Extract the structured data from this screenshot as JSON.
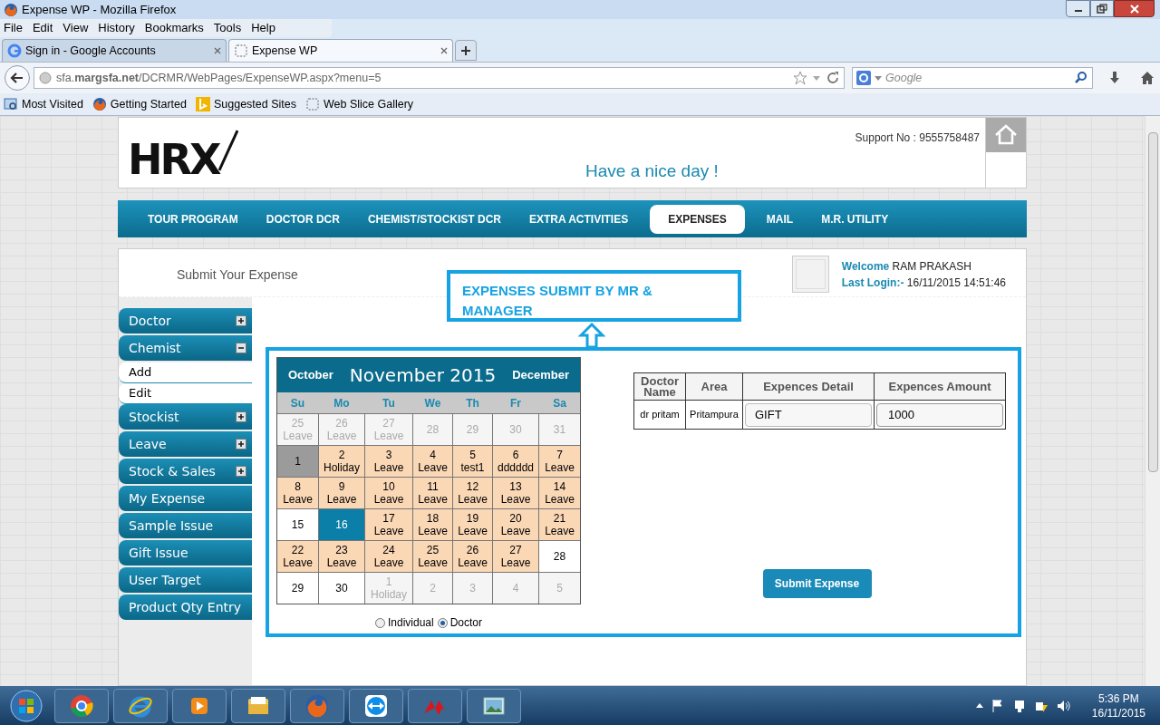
{
  "window": {
    "title": "Expense WP - Mozilla Firefox"
  },
  "menu": [
    "File",
    "Edit",
    "View",
    "History",
    "Bookmarks",
    "Tools",
    "Help"
  ],
  "browser_tabs": [
    {
      "label": "Sign in - Google Accounts",
      "selected": false
    },
    {
      "label": "Expense WP",
      "selected": true
    }
  ],
  "address": "sfa.**margsfa.net**/DCRMR/WebPages/ExpenseWP.aspx?menu=5",
  "search": {
    "placeholder": "Google"
  },
  "bookmarks": [
    "Most Visited",
    "Getting Started",
    "Suggested Sites",
    "Web Slice Gallery"
  ],
  "header": {
    "logo": "HRX",
    "support": "Support No : 9555758487",
    "greeting": "Have a nice day !"
  },
  "nav": [
    {
      "label": "TOUR PROGRAM",
      "selected": false
    },
    {
      "label": "DOCTOR DCR",
      "selected": false
    },
    {
      "label": "CHEMIST/STOCKIST DCR",
      "selected": false
    },
    {
      "label": "EXTRA ACTIVITIES",
      "selected": false
    },
    {
      "label": "EXPENSES",
      "selected": true
    },
    {
      "label": "MAIL",
      "selected": false
    },
    {
      "label": "M.R. UTILITY",
      "selected": false
    }
  ],
  "page_title": "Submit Your Expense",
  "user": {
    "welcome_label": "Welcome",
    "name": "RAM PRAKASH",
    "login_label": "Last Login:-",
    "last_login": "16/11/2015 14:51:46"
  },
  "callout": "EXPENSES SUBMIT BY MR & MANAGER",
  "sidebar": [
    {
      "label": "Doctor",
      "expanded": false
    },
    {
      "label": "Chemist",
      "expanded": true,
      "children": [
        "Add",
        "Edit"
      ]
    },
    {
      "label": "Stockist",
      "expanded": false
    },
    {
      "label": "Leave",
      "expanded": false
    },
    {
      "label": "Stock & Sales",
      "expanded": false
    },
    {
      "label": "My Expense"
    },
    {
      "label": "Sample Issue"
    },
    {
      "label": "Gift Issue"
    },
    {
      "label": "User Target"
    },
    {
      "label": "Product Qty Entry"
    }
  ],
  "calendar": {
    "prev": "October",
    "title": "November 2015",
    "next": "December",
    "weekdays": [
      "Su",
      "Mo",
      "Tu",
      "We",
      "Th",
      "Fr",
      "Sa"
    ],
    "days": [
      {
        "day": "25",
        "note": "Leave",
        "kind": "outside",
        "selected": false
      },
      {
        "day": "26",
        "note": "Leave",
        "kind": "outside",
        "selected": false
      },
      {
        "day": "27",
        "note": "Leave",
        "kind": "outside",
        "selected": false
      },
      {
        "day": "28",
        "kind": "outside",
        "selected": false
      },
      {
        "day": "29",
        "kind": "outside",
        "selected": false
      },
      {
        "day": "30",
        "kind": "outside",
        "selected": false
      },
      {
        "day": "31",
        "kind": "outside",
        "selected": false
      },
      {
        "day": "1",
        "kind": "today",
        "selected": false
      },
      {
        "day": "2",
        "note": "Holiday",
        "kind": "marked",
        "selected": false
      },
      {
        "day": "3",
        "note": "Leave",
        "kind": "marked",
        "selected": false
      },
      {
        "day": "4",
        "note": "Leave",
        "kind": "marked",
        "selected": false
      },
      {
        "day": "5",
        "note": "test1",
        "kind": "marked",
        "selected": false
      },
      {
        "day": "6",
        "note": "dddddd",
        "kind": "marked",
        "selected": false
      },
      {
        "day": "7",
        "note": "Leave",
        "kind": "marked",
        "selected": false
      },
      {
        "day": "8",
        "note": "Leave",
        "kind": "marked",
        "selected": false
      },
      {
        "day": "9",
        "note": "Leave",
        "kind": "marked",
        "selected": false
      },
      {
        "day": "10",
        "note": "Leave",
        "kind": "marked",
        "selected": false
      },
      {
        "day": "11",
        "note": "Leave",
        "kind": "marked",
        "selected": false
      },
      {
        "day": "12",
        "note": "Leave",
        "kind": "marked",
        "selected": false
      },
      {
        "day": "13",
        "note": "Leave",
        "kind": "marked",
        "selected": false
      },
      {
        "day": "14",
        "note": "Leave",
        "kind": "marked",
        "selected": false
      },
      {
        "day": "15",
        "kind": "plain",
        "selected": false
      },
      {
        "day": "16",
        "kind": "plain",
        "selected": true
      },
      {
        "day": "17",
        "note": "Leave",
        "kind": "marked",
        "selected": false
      },
      {
        "day": "18",
        "note": "Leave",
        "kind": "marked",
        "selected": false
      },
      {
        "day": "19",
        "note": "Leave",
        "kind": "marked",
        "selected": false
      },
      {
        "day": "20",
        "note": "Leave",
        "kind": "marked",
        "selected": false
      },
      {
        "day": "21",
        "note": "Leave",
        "kind": "marked",
        "selected": false
      },
      {
        "day": "22",
        "note": "Leave",
        "kind": "marked",
        "selected": false
      },
      {
        "day": "23",
        "note": "Leave",
        "kind": "marked",
        "selected": false
      },
      {
        "day": "24",
        "note": "Leave",
        "kind": "marked",
        "selected": false
      },
      {
        "day": "25",
        "note": "Leave",
        "kind": "marked",
        "selected": false
      },
      {
        "day": "26",
        "note": "Leave",
        "kind": "marked",
        "selected": false
      },
      {
        "day": "27",
        "note": "Leave",
        "kind": "marked",
        "selected": false
      },
      {
        "day": "28",
        "kind": "plain",
        "selected": false
      },
      {
        "day": "29",
        "kind": "plain",
        "selected": false
      },
      {
        "day": "30",
        "kind": "plain",
        "selected": false
      },
      {
        "day": "1",
        "note": "Holiday",
        "kind": "outside",
        "selected": false
      },
      {
        "day": "2",
        "kind": "outside",
        "selected": false
      },
      {
        "day": "3",
        "kind": "outside",
        "selected": false
      },
      {
        "day": "4",
        "kind": "outside",
        "selected": false
      },
      {
        "day": "5",
        "kind": "outside",
        "selected": false
      }
    ]
  },
  "mode": [
    {
      "label": "Individual",
      "selected": false
    },
    {
      "label": "Doctor",
      "selected": true
    }
  ],
  "table": {
    "columns": [
      "Doctor Name",
      "Area",
      "Expences Detail",
      "Expences Amount"
    ],
    "rows": [
      {
        "doctor": "dr pritam",
        "area": "Pritampura",
        "detail": "GIFT",
        "amount": "1000"
      }
    ]
  },
  "submit": "Submit Expense",
  "clock": {
    "time": "5:36 PM",
    "date": "16/11/2015"
  }
}
